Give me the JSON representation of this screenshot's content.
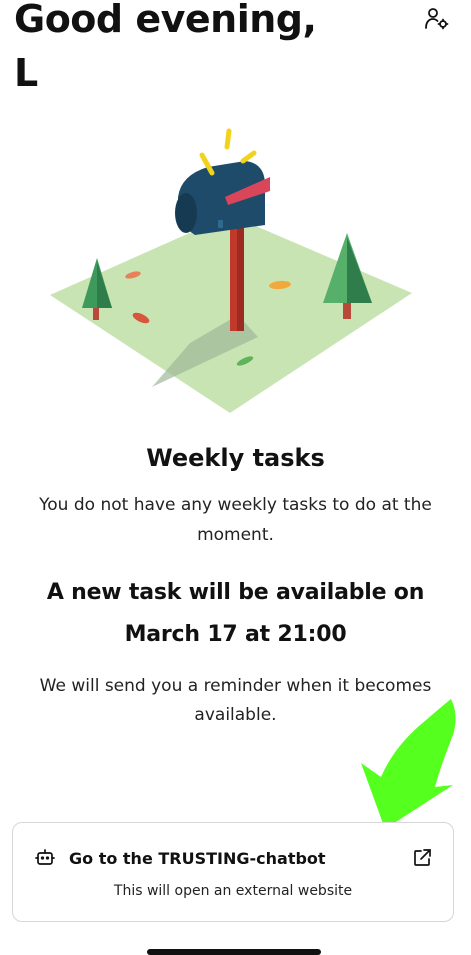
{
  "header": {
    "greeting": "Good evening,",
    "user_name": "L",
    "profile_icon": "user-settings-icon"
  },
  "illustration": {
    "name": "mailbox-illustration",
    "colors": {
      "ground": "#c8e4b3",
      "mailbox": "#1f4b6a",
      "post": "#c0392b",
      "trees": "#57b06a",
      "sparkle": "#f3d21c"
    }
  },
  "weekly": {
    "title": "Weekly tasks",
    "description": "You do not have any weekly tasks to do at the moment."
  },
  "next_task": {
    "text": "A new task will be available on March 17 at 21:00"
  },
  "reminder": {
    "text": "We will send you a reminder when it becomes available."
  },
  "annotation": {
    "arrow_color": "#55ff1e"
  },
  "chatbot_card": {
    "icon": "robot-icon",
    "title": "Go to the TRUSTING-chatbot",
    "external_icon": "external-link-icon",
    "subtitle": "This will open an external website"
  }
}
